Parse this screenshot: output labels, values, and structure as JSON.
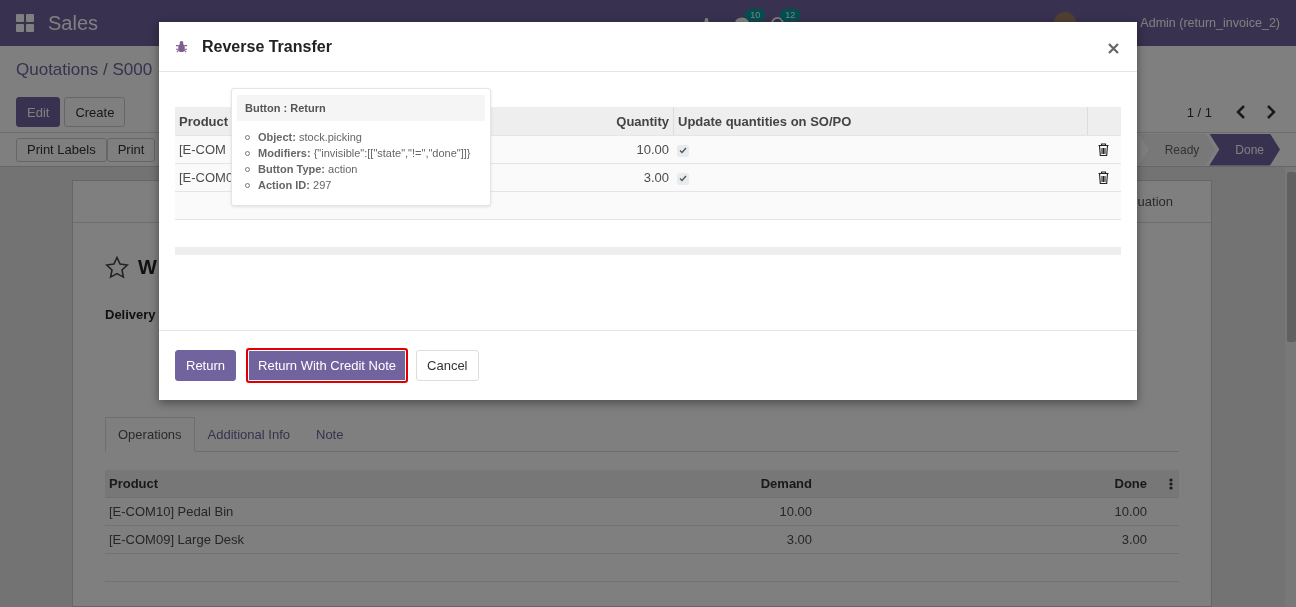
{
  "navbar": {
    "app": "Sales",
    "chat_count": "10",
    "activity_count": "12",
    "user": "Admin (return_invoice_2)"
  },
  "breadcrumb": "Quotations / S000",
  "actions": [
    {
      "label": "Edit",
      "kind": "primary"
    },
    {
      "label": "Create",
      "kind": "secondary"
    }
  ],
  "pager": "1 / 1",
  "print_buttons": [
    "Print Labels",
    "Print"
  ],
  "stages": [
    {
      "label": "Ready",
      "selected": false
    },
    {
      "label": "Done",
      "selected": true
    }
  ],
  "sheet": {
    "smart_button": "uation",
    "title": "W",
    "field_label": "Delivery",
    "tabs": [
      {
        "label": "Operations",
        "selected": true
      },
      {
        "label": "Additional Info",
        "selected": false
      },
      {
        "label": "Note",
        "selected": false
      }
    ],
    "table": {
      "columns": [
        "Product",
        "Demand",
        "Done"
      ],
      "rows": [
        {
          "product": "[E-COM10] Pedal Bin",
          "demand": "10.00",
          "done": "10.00"
        },
        {
          "product": "[E-COM09] Large Desk",
          "demand": "3.00",
          "done": "3.00"
        }
      ]
    }
  },
  "dialog": {
    "title": "Reverse Transfer",
    "columns": [
      "Product",
      "Quantity",
      "Update quantities on SO/PO"
    ],
    "rows": [
      {
        "product": "[E-COM",
        "quantity": "10.00",
        "checked": true
      },
      {
        "product": "[E-COM0",
        "quantity": "3.00",
        "checked": true
      }
    ],
    "buttons": [
      {
        "label": "Return",
        "kind": "primary",
        "highlighted": false
      },
      {
        "label": "Return With Credit Note",
        "kind": "primary",
        "highlighted": true
      },
      {
        "label": "Cancel",
        "kind": "secondary",
        "highlighted": false
      }
    ]
  },
  "tooltip": {
    "title": "Button : Return",
    "items": [
      {
        "label": "Object:",
        "value": "stock.picking"
      },
      {
        "label": "Modifiers:",
        "value": "{\"invisible\":[[\"state\",\"!=\",\"done\"]]}"
      },
      {
        "label": "Button Type:",
        "value": "action"
      },
      {
        "label": "Action ID:",
        "value": "297"
      }
    ]
  }
}
